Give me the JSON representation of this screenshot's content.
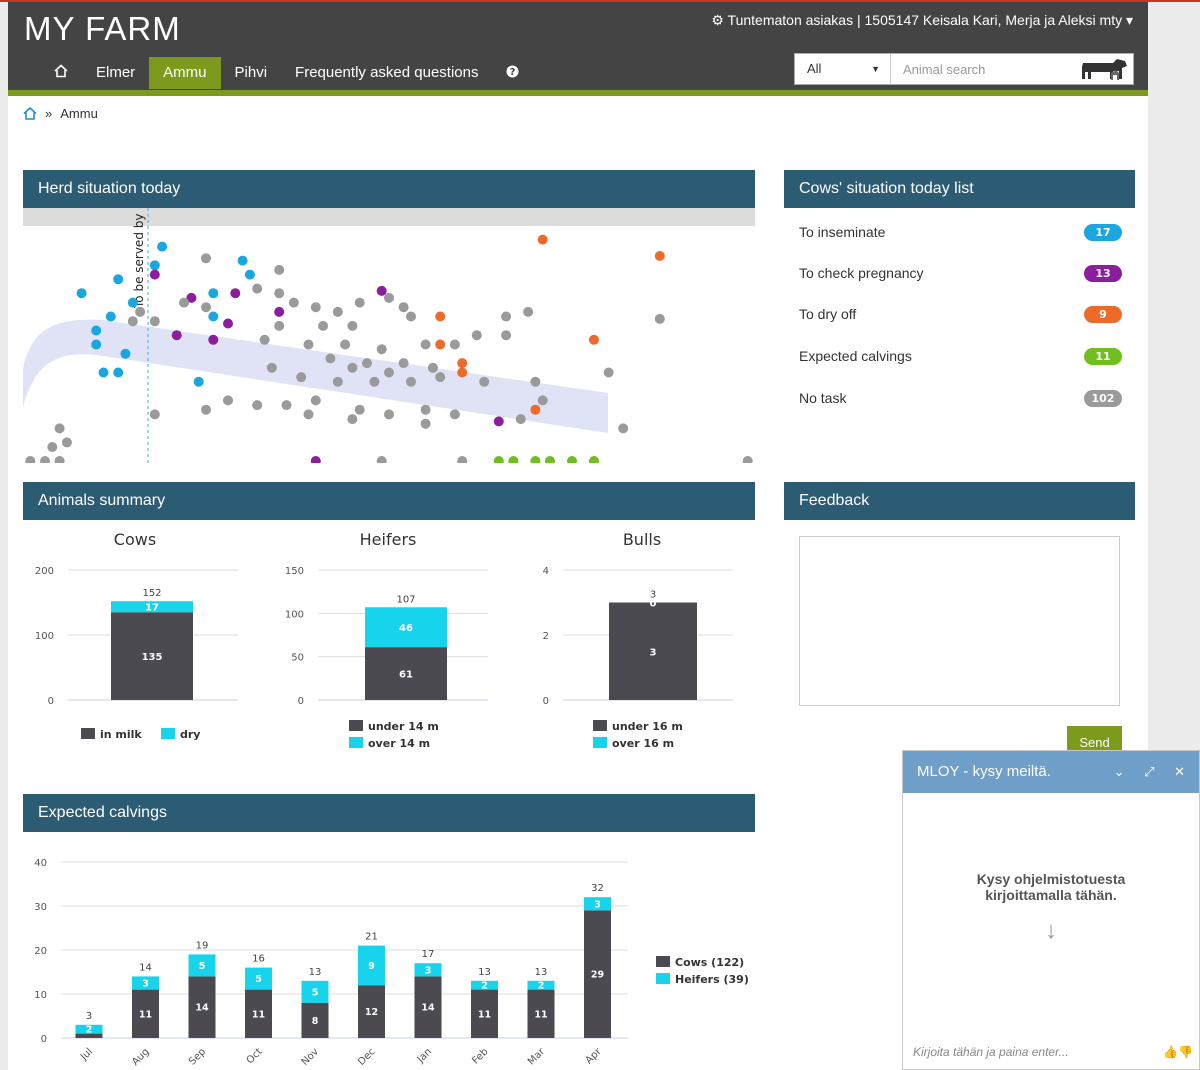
{
  "header": {
    "brand": "MY FARM",
    "account": "Tuntematon asiakas | 1505147 Keisala Kari, Merja ja Aleksi mty ▾",
    "nav": [
      {
        "label": "Elmer"
      },
      {
        "label": "Ammu",
        "active": true
      },
      {
        "label": "Pihvi"
      },
      {
        "label": "Frequently asked questions"
      }
    ],
    "search": {
      "filter": "All",
      "placeholder": "Animal search"
    }
  },
  "breadcrumb": {
    "separator": "»",
    "current": "Ammu"
  },
  "herd": {
    "title": "Herd situation today",
    "vline_label": "To be served by",
    "chart_data": {
      "type": "scatter",
      "colors": {
        "inseminate": "#1aa7e0",
        "pregnancy": "#8a1e9e",
        "dry_off": "#ee6a2b",
        "calving": "#6fbf1f",
        "no_task": "#9a9a9a"
      },
      "band_color": "#dfe3f5",
      "points": [
        {
          "x": 0.13,
          "y": 0.22,
          "cat": "inseminate"
        },
        {
          "x": 0.18,
          "y": 0.16,
          "cat": "inseminate"
        },
        {
          "x": 0.08,
          "y": 0.28,
          "cat": "inseminate"
        },
        {
          "x": 0.15,
          "y": 0.32,
          "cat": "inseminate"
        },
        {
          "x": 0.12,
          "y": 0.38,
          "cat": "inseminate"
        },
        {
          "x": 0.1,
          "y": 0.44,
          "cat": "inseminate"
        },
        {
          "x": 0.1,
          "y": 0.5,
          "cat": "inseminate"
        },
        {
          "x": 0.14,
          "y": 0.54,
          "cat": "inseminate"
        },
        {
          "x": 0.13,
          "y": 0.62,
          "cat": "inseminate"
        },
        {
          "x": 0.11,
          "y": 0.62,
          "cat": "inseminate"
        },
        {
          "x": 0.19,
          "y": 0.08,
          "cat": "inseminate"
        },
        {
          "x": 0.3,
          "y": 0.14,
          "cat": "inseminate"
        },
        {
          "x": 0.31,
          "y": 0.2,
          "cat": "inseminate"
        },
        {
          "x": 0.26,
          "y": 0.28,
          "cat": "inseminate"
        },
        {
          "x": 0.26,
          "y": 0.38,
          "cat": "inseminate"
        },
        {
          "x": 0.24,
          "y": 0.66,
          "cat": "inseminate"
        },
        {
          "x": 0.18,
          "y": 0.2,
          "cat": "pregnancy"
        },
        {
          "x": 0.23,
          "y": 0.3,
          "cat": "pregnancy"
        },
        {
          "x": 0.29,
          "y": 0.28,
          "cat": "pregnancy"
        },
        {
          "x": 0.21,
          "y": 0.46,
          "cat": "pregnancy"
        },
        {
          "x": 0.26,
          "y": 0.48,
          "cat": "pregnancy"
        },
        {
          "x": 0.28,
          "y": 0.41,
          "cat": "pregnancy"
        },
        {
          "x": 0.49,
          "y": 0.27,
          "cat": "pregnancy"
        },
        {
          "x": 0.35,
          "y": 0.36,
          "cat": "pregnancy"
        },
        {
          "x": 0.65,
          "y": 0.83,
          "cat": "pregnancy"
        },
        {
          "x": 0.4,
          "y": 1.0,
          "cat": "pregnancy"
        },
        {
          "x": 0.71,
          "y": 0.05,
          "cat": "dry_off"
        },
        {
          "x": 0.87,
          "y": 0.12,
          "cat": "dry_off"
        },
        {
          "x": 0.57,
          "y": 0.38,
          "cat": "dry_off"
        },
        {
          "x": 0.57,
          "y": 0.5,
          "cat": "dry_off"
        },
        {
          "x": 0.6,
          "y": 0.58,
          "cat": "dry_off"
        },
        {
          "x": 0.6,
          "y": 0.62,
          "cat": "dry_off"
        },
        {
          "x": 0.78,
          "y": 0.48,
          "cat": "dry_off"
        },
        {
          "x": 0.7,
          "y": 0.78,
          "cat": "dry_off"
        },
        {
          "x": 0.65,
          "y": 1.0,
          "cat": "calving"
        },
        {
          "x": 0.67,
          "y": 1.0,
          "cat": "calving"
        },
        {
          "x": 0.7,
          "y": 1.0,
          "cat": "calving"
        },
        {
          "x": 0.72,
          "y": 1.0,
          "cat": "calving"
        },
        {
          "x": 0.75,
          "y": 1.0,
          "cat": "calving"
        },
        {
          "x": 0.78,
          "y": 1.0,
          "cat": "calving"
        },
        {
          "x": 0.25,
          "y": 0.13,
          "cat": "no_task"
        },
        {
          "x": 0.22,
          "y": 0.32,
          "cat": "no_task"
        },
        {
          "x": 0.25,
          "y": 0.34,
          "cat": "no_task"
        },
        {
          "x": 0.37,
          "y": 0.32,
          "cat": "no_task"
        },
        {
          "x": 0.4,
          "y": 0.34,
          "cat": "no_task"
        },
        {
          "x": 0.43,
          "y": 0.36,
          "cat": "no_task"
        },
        {
          "x": 0.46,
          "y": 0.32,
          "cat": "no_task"
        },
        {
          "x": 0.5,
          "y": 0.3,
          "cat": "no_task"
        },
        {
          "x": 0.35,
          "y": 0.42,
          "cat": "no_task"
        },
        {
          "x": 0.41,
          "y": 0.42,
          "cat": "no_task"
        },
        {
          "x": 0.45,
          "y": 0.42,
          "cat": "no_task"
        },
        {
          "x": 0.53,
          "y": 0.38,
          "cat": "no_task"
        },
        {
          "x": 0.33,
          "y": 0.48,
          "cat": "no_task"
        },
        {
          "x": 0.39,
          "y": 0.5,
          "cat": "no_task"
        },
        {
          "x": 0.44,
          "y": 0.5,
          "cat": "no_task"
        },
        {
          "x": 0.49,
          "y": 0.52,
          "cat": "no_task"
        },
        {
          "x": 0.55,
          "y": 0.5,
          "cat": "no_task"
        },
        {
          "x": 0.59,
          "y": 0.5,
          "cat": "no_task"
        },
        {
          "x": 0.62,
          "y": 0.46,
          "cat": "no_task"
        },
        {
          "x": 0.66,
          "y": 0.46,
          "cat": "no_task"
        },
        {
          "x": 0.42,
          "y": 0.56,
          "cat": "no_task"
        },
        {
          "x": 0.47,
          "y": 0.58,
          "cat": "no_task"
        },
        {
          "x": 0.52,
          "y": 0.58,
          "cat": "no_task"
        },
        {
          "x": 0.56,
          "y": 0.6,
          "cat": "no_task"
        },
        {
          "x": 0.45,
          "y": 0.6,
          "cat": "no_task"
        },
        {
          "x": 0.5,
          "y": 0.62,
          "cat": "no_task"
        },
        {
          "x": 0.34,
          "y": 0.6,
          "cat": "no_task"
        },
        {
          "x": 0.38,
          "y": 0.64,
          "cat": "no_task"
        },
        {
          "x": 0.43,
          "y": 0.66,
          "cat": "no_task"
        },
        {
          "x": 0.48,
          "y": 0.66,
          "cat": "no_task"
        },
        {
          "x": 0.53,
          "y": 0.66,
          "cat": "no_task"
        },
        {
          "x": 0.57,
          "y": 0.64,
          "cat": "no_task"
        },
        {
          "x": 0.63,
          "y": 0.66,
          "cat": "no_task"
        },
        {
          "x": 0.7,
          "y": 0.66,
          "cat": "no_task"
        },
        {
          "x": 0.28,
          "y": 0.74,
          "cat": "no_task"
        },
        {
          "x": 0.32,
          "y": 0.76,
          "cat": "no_task"
        },
        {
          "x": 0.36,
          "y": 0.76,
          "cat": "no_task"
        },
        {
          "x": 0.4,
          "y": 0.74,
          "cat": "no_task"
        },
        {
          "x": 0.46,
          "y": 0.78,
          "cat": "no_task"
        },
        {
          "x": 0.5,
          "y": 0.8,
          "cat": "no_task"
        },
        {
          "x": 0.55,
          "y": 0.78,
          "cat": "no_task"
        },
        {
          "x": 0.59,
          "y": 0.8,
          "cat": "no_task"
        },
        {
          "x": 0.25,
          "y": 0.78,
          "cat": "no_task"
        },
        {
          "x": 0.18,
          "y": 0.8,
          "cat": "no_task"
        },
        {
          "x": 0.39,
          "y": 0.8,
          "cat": "no_task"
        },
        {
          "x": 0.45,
          "y": 0.82,
          "cat": "no_task"
        },
        {
          "x": 0.55,
          "y": 0.84,
          "cat": "no_task"
        },
        {
          "x": 0.68,
          "y": 0.82,
          "cat": "no_task"
        },
        {
          "x": 0.71,
          "y": 0.74,
          "cat": "no_task"
        },
        {
          "x": 0.8,
          "y": 0.62,
          "cat": "no_task"
        },
        {
          "x": 0.87,
          "y": 0.39,
          "cat": "no_task"
        },
        {
          "x": 0.69,
          "y": 0.36,
          "cat": "no_task"
        },
        {
          "x": 0.66,
          "y": 0.38,
          "cat": "no_task"
        },
        {
          "x": 0.52,
          "y": 0.34,
          "cat": "no_task"
        },
        {
          "x": 0.32,
          "y": 0.26,
          "cat": "no_task"
        },
        {
          "x": 0.18,
          "y": 0.4,
          "cat": "no_task"
        },
        {
          "x": 0.16,
          "y": 0.36,
          "cat": "no_task"
        },
        {
          "x": 0.15,
          "y": 0.4,
          "cat": "no_task"
        },
        {
          "x": 0.35,
          "y": 0.18,
          "cat": "no_task"
        },
        {
          "x": 0.35,
          "y": 0.28,
          "cat": "no_task"
        },
        {
          "x": 0.05,
          "y": 0.86,
          "cat": "no_task"
        },
        {
          "x": 0.06,
          "y": 0.92,
          "cat": "no_task"
        },
        {
          "x": 0.04,
          "y": 0.94,
          "cat": "no_task"
        },
        {
          "x": 0.05,
          "y": 1.0,
          "cat": "no_task"
        },
        {
          "x": 0.01,
          "y": 1.0,
          "cat": "no_task"
        },
        {
          "x": 0.03,
          "y": 1.0,
          "cat": "no_task"
        },
        {
          "x": 0.6,
          "y": 1.0,
          "cat": "no_task"
        },
        {
          "x": 0.49,
          "y": 1.0,
          "cat": "no_task"
        },
        {
          "x": 0.99,
          "y": 1.0,
          "cat": "no_task"
        },
        {
          "x": 0.82,
          "y": 0.86,
          "cat": "no_task"
        }
      ]
    }
  },
  "tasks": {
    "title": "Cows' situation today list",
    "items": [
      {
        "label": "To inseminate",
        "count": "17",
        "color": "#1aa7e0"
      },
      {
        "label": "To check pregnancy",
        "count": "13",
        "color": "#8a1e9e"
      },
      {
        "label": "To dry off",
        "count": "9",
        "color": "#ee6a2b"
      },
      {
        "label": "Expected calvings",
        "count": "11",
        "color": "#6fbf1f"
      },
      {
        "label": "No task",
        "count": "102",
        "color": "#9a9a9a"
      }
    ]
  },
  "summary": {
    "title": "Animals summary",
    "chart_data": [
      {
        "type": "bar",
        "title": "Cows",
        "ylim": [
          0,
          200
        ],
        "ticks": [
          0,
          100,
          200
        ],
        "series": [
          {
            "name": "in milk",
            "values": [
              135
            ],
            "color": "#4a4a50"
          },
          {
            "name": "dry",
            "values": [
              17
            ],
            "color": "#17d4ec"
          }
        ],
        "total": 152,
        "legend_layout": "row"
      },
      {
        "type": "bar",
        "title": "Heifers",
        "ylim": [
          0,
          150
        ],
        "ticks": [
          0,
          50,
          100,
          150
        ],
        "series": [
          {
            "name": "under 14 m",
            "values": [
              61
            ],
            "color": "#4a4a50"
          },
          {
            "name": "over 14 m",
            "values": [
              46
            ],
            "color": "#17d4ec"
          }
        ],
        "total": 107,
        "legend_layout": "column"
      },
      {
        "type": "bar",
        "title": "Bulls",
        "ylim": [
          0,
          4
        ],
        "ticks": [
          0,
          2,
          4
        ],
        "series": [
          {
            "name": "under 16 m",
            "values": [
              3
            ],
            "color": "#4a4a50"
          },
          {
            "name": "over 16 m",
            "values": [
              0
            ],
            "color": "#17d4ec"
          }
        ],
        "total": 3,
        "legend_layout": "column"
      }
    ]
  },
  "feedback": {
    "title": "Feedback",
    "send_label": "Send"
  },
  "calvings": {
    "title": "Expected calvings",
    "chart_data": {
      "type": "bar",
      "categories": [
        "Jul",
        "Aug",
        "Sep",
        "Oct",
        "Nov",
        "Dec",
        "Jan",
        "Feb",
        "Mar",
        "Apr"
      ],
      "ylim": [
        0,
        40
      ],
      "ticks": [
        0,
        10,
        20,
        30,
        40
      ],
      "series": [
        {
          "name": "Cows (122)",
          "values": [
            1,
            11,
            14,
            11,
            8,
            12,
            14,
            11,
            11,
            29
          ],
          "color": "#4a4a50"
        },
        {
          "name": "Heifers (39)",
          "values": [
            2,
            3,
            5,
            5,
            5,
            9,
            3,
            2,
            2,
            3
          ],
          "color": "#17d4ec"
        }
      ],
      "totals": [
        3,
        14,
        19,
        16,
        13,
        21,
        17,
        13,
        13,
        32
      ]
    }
  },
  "chat": {
    "title": "MLOY - kysy meiltä.",
    "controls": "⌄ ⤢ ✕",
    "message_line1": "Kysy  ohjelmistotuesta",
    "message_line2": "kirjoittamalla tähän.",
    "input_placeholder": "Kirjoita tähän ja paina enter...",
    "rating": "👍👎"
  }
}
